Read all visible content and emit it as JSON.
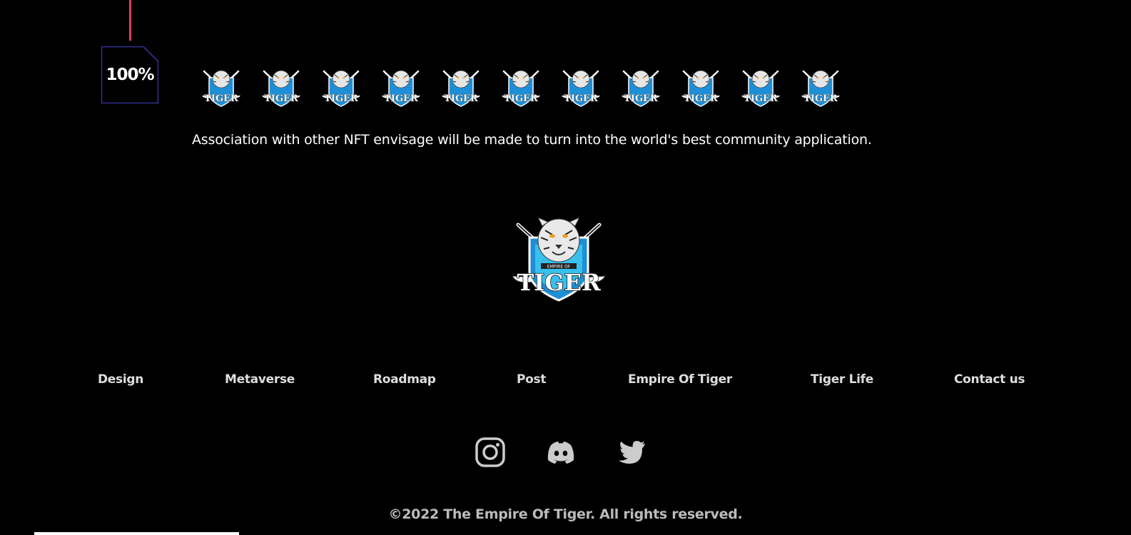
{
  "roadmap": {
    "milestone_percent": "100%",
    "milestone_text": "Association with other NFT envisage will be made to turn into the world's best community application.",
    "nft_logo_count": 11,
    "colors": {
      "timeline": "#d9405c",
      "badge_border": "#3a36a8"
    }
  },
  "footer": {
    "brand_logo": {
      "icon": "empire-of-tiger-logo",
      "top_text": "EMPIRE OF",
      "main_text": "TIGER"
    },
    "nav": [
      {
        "label": "Design"
      },
      {
        "label": "Metaverse"
      },
      {
        "label": "Roadmap"
      },
      {
        "label": "Post"
      },
      {
        "label": "Empire Of Tiger"
      },
      {
        "label": "Tiger Life"
      },
      {
        "label": "Contact us"
      }
    ],
    "social": [
      {
        "icon": "instagram-icon"
      },
      {
        "icon": "discord-icon"
      },
      {
        "icon": "twitter-icon"
      }
    ],
    "copyright": "©2022 The Empire Of Tiger. All rights reserved."
  }
}
